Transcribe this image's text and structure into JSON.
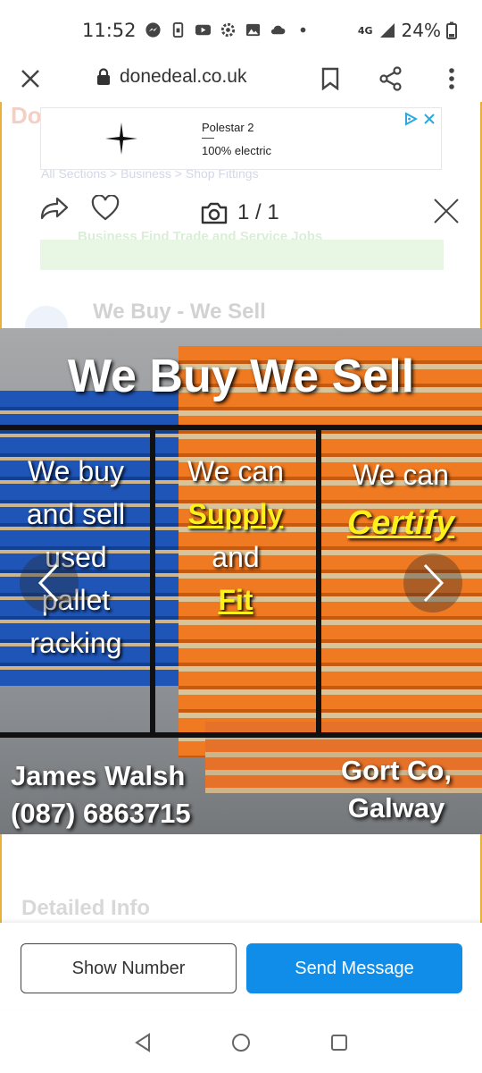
{
  "status_bar": {
    "time": "11:52",
    "network": "4G",
    "battery": "24%"
  },
  "browser": {
    "url": "donedeal.co.uk"
  },
  "background_page": {
    "breadcrumb": "All Sections   >   Business   >   Shop Fittings",
    "seller_name": "We Buy - We Sell",
    "green_banner": "Business      Find Trade and Service Jobs",
    "section_heading": "Detailed Info"
  },
  "ad": {
    "brand": "Polestar 2",
    "tagline": "100% electric"
  },
  "viewer": {
    "counter": "1 / 1"
  },
  "photo": {
    "headline": "We Buy We Sell",
    "col1": [
      "We buy",
      "and sell",
      "used",
      "pallet",
      "racking"
    ],
    "col2_top": "We can",
    "col2_word1": "Supply",
    "col2_mid": "and",
    "col2_word2": "Fit",
    "col3_top": "We can",
    "col3_word": "Certify",
    "contact_name": "James Walsh",
    "contact_phone": "(087) 6863715",
    "location_line1": "Gort Co,",
    "location_line2": "Galway"
  },
  "actions": {
    "show_number": "Show Number",
    "send_message": "Send Message"
  },
  "colors": {
    "accent_blue": "#0f8de8",
    "page_border": "#e8b23a",
    "highlight_yellow": "#ffef1a"
  }
}
